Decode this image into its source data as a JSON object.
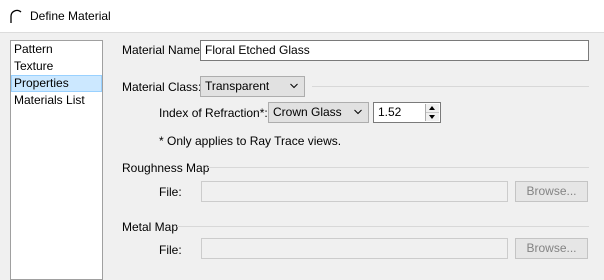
{
  "window": {
    "title": "Define Material",
    "icon": "arch-icon"
  },
  "sidebar": {
    "items": [
      {
        "label": "Pattern",
        "selected": false
      },
      {
        "label": "Texture",
        "selected": false
      },
      {
        "label": "Properties",
        "selected": true
      },
      {
        "label": "Materials List",
        "selected": false
      }
    ]
  },
  "material_name": {
    "label": "Material Name:",
    "value": "Floral Etched Glass"
  },
  "material_class": {
    "label": "Material Class:",
    "value": "Transparent"
  },
  "refraction": {
    "label": "Index of Refraction*:",
    "preset": "Crown Glass",
    "value": "1.52"
  },
  "note": "* Only applies to Ray Trace views.",
  "roughness_map": {
    "heading": "Roughness Map",
    "file_label": "File:",
    "file_value": "",
    "browse_label": "Browse..."
  },
  "metal_map": {
    "heading": "Metal Map",
    "file_label": "File:",
    "file_value": "",
    "browse_label": "Browse..."
  },
  "colors": {
    "selection": "#cce8ff",
    "background": "#f0f0f0"
  }
}
